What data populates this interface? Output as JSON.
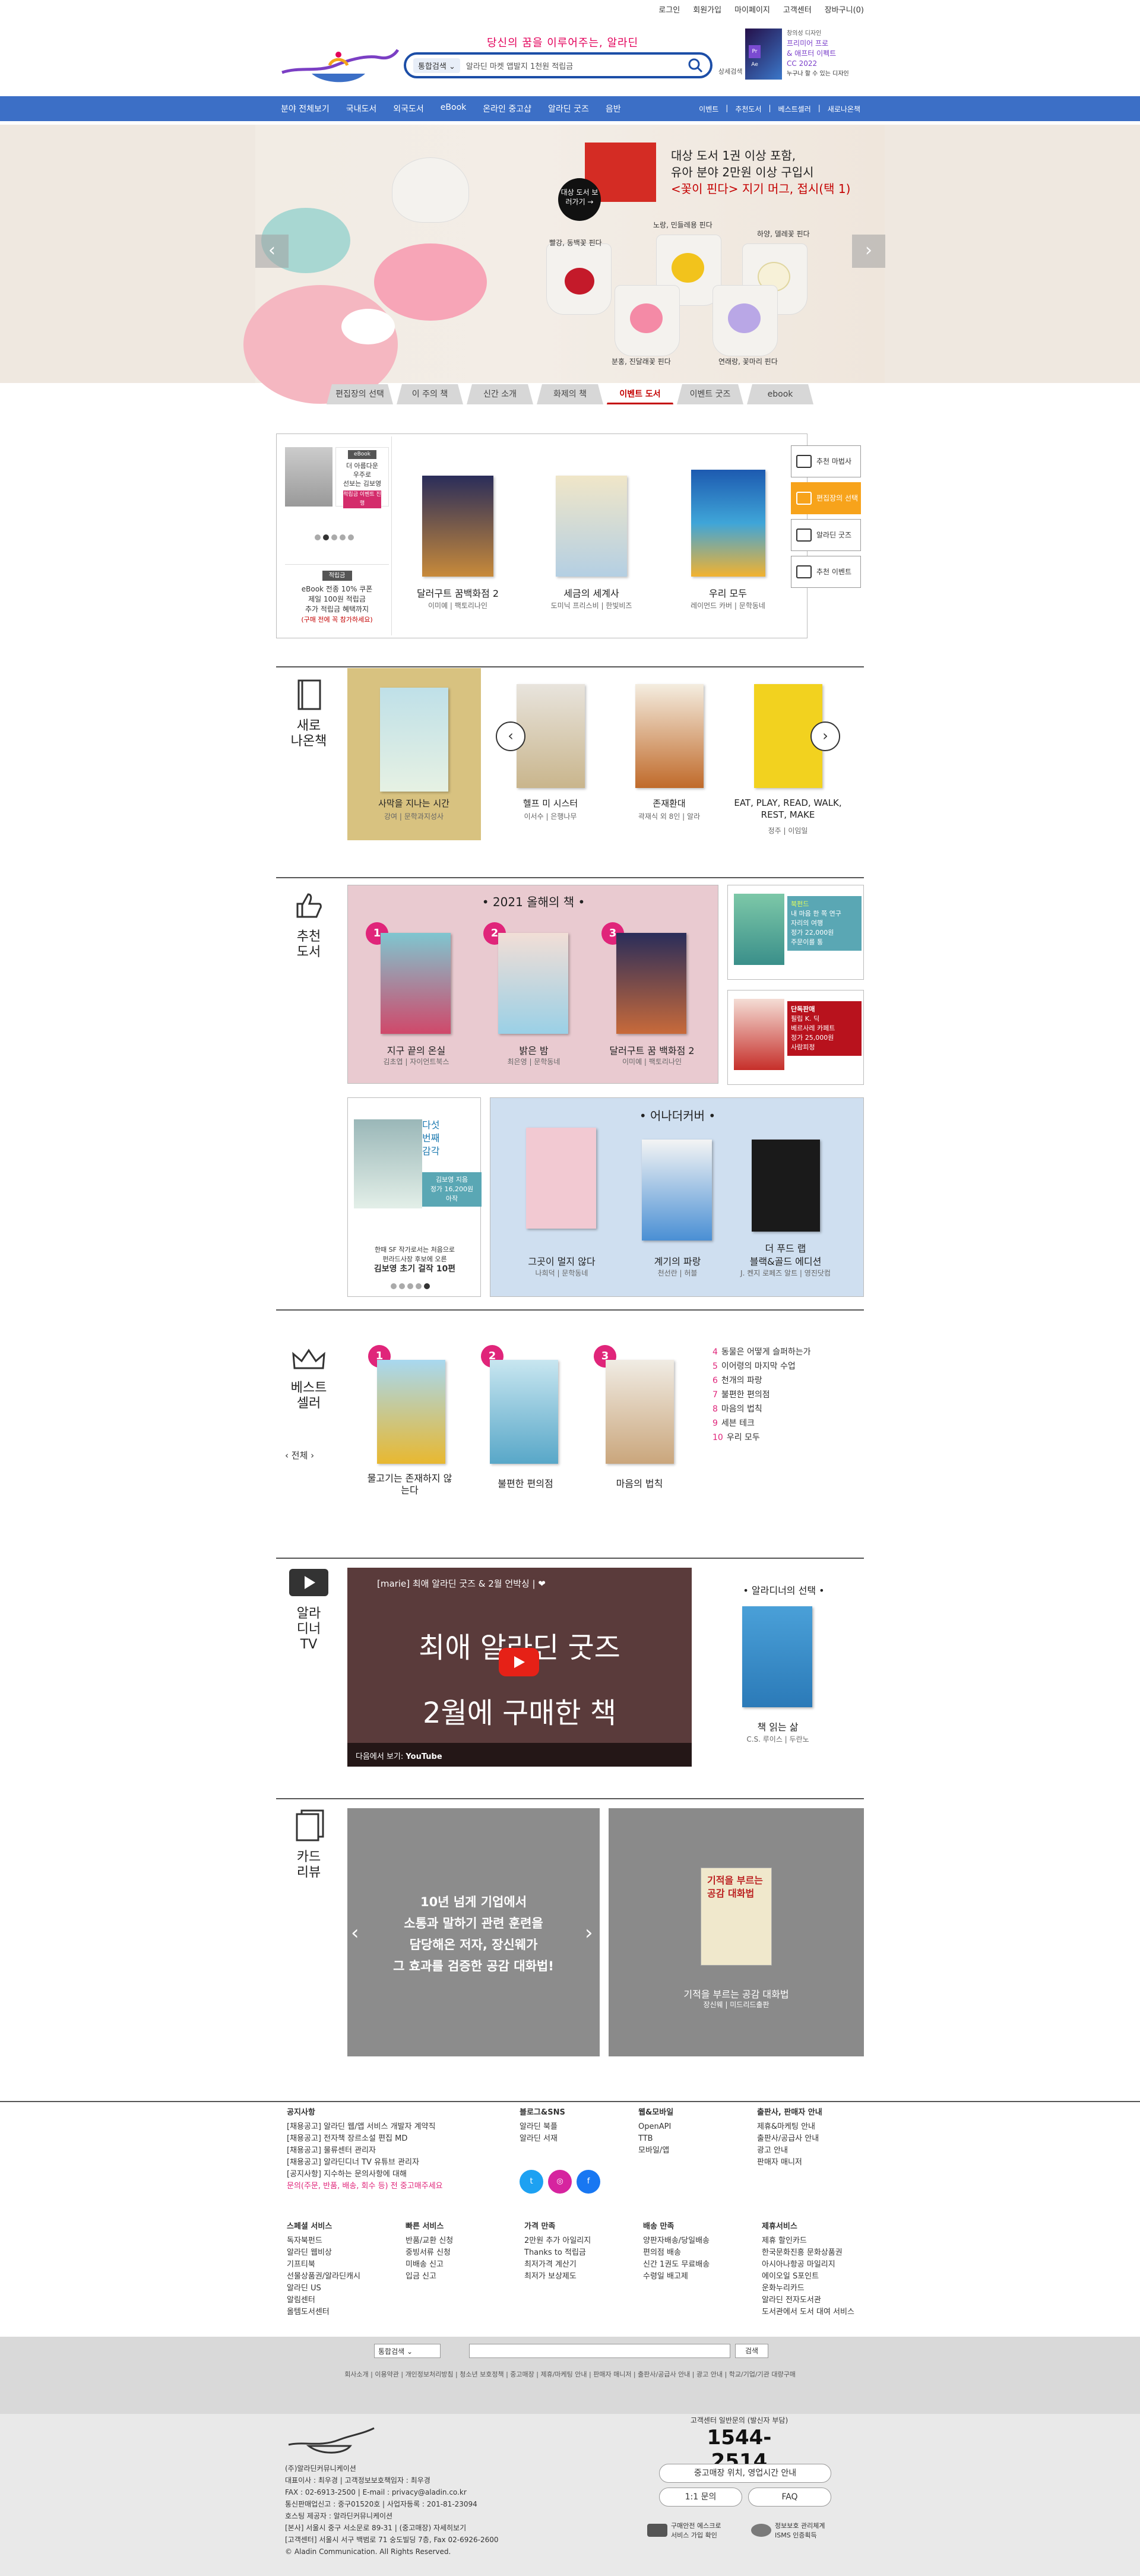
{
  "toplinks": [
    "로그인",
    "회원가입",
    "마이페이지",
    "고객센터",
    "장바구니(0)"
  ],
  "header": {
    "slogan": "당신의 꿈을 이루어주는, 알라딘",
    "search_category": "통합검색",
    "search_query": "알라딘 마켓 앱발지 1천원 적립금",
    "detail_search": "상세검색",
    "ad_lines": [
      "창의성 디자인",
      "프리미어 프로",
      "& 애프터 이펙트",
      "CC 2022",
      "누구나 할 수 있는 디자인"
    ]
  },
  "nav": {
    "left": [
      "분야 전체보기",
      "국내도서",
      "외국도서",
      "eBook",
      "온라인 중고샵",
      "알라딘 굿즈",
      "음반"
    ],
    "right": [
      "이벤트",
      "추천도서",
      "베스트셀러",
      "새로나온책"
    ]
  },
  "banner": {
    "line1": "대상 도서 1권 이상 포함,",
    "line2": "유아 분야 2만원 이상 구입시",
    "line3": "<꽃이 핀다> 지기 머그, 접시(택 1)",
    "go_button": "대상 도서 보러가기 →",
    "labels": [
      "노랑, 민들레용 핀다",
      "하양, 델레꽃 핀다",
      "빨강, 동백꽃 핀다",
      "분홍, 진달래꽃 핀다",
      "연래랑, 꽃마리 핀다"
    ]
  },
  "tabs": [
    "편집장의 선택",
    "이 주의 책",
    "신간 소개",
    "화제의 책",
    "이벤트 도서",
    "이벤트 굿즈",
    "ebook"
  ],
  "editor": {
    "card_tag": "eBook",
    "card_text": [
      "더 아름다운",
      "우주로",
      "선보는 김보영"
    ],
    "card_pick": "적립금 이벤트 진행",
    "promo_tag": "적립금",
    "promo": [
      "eBook 전종 10% 쿠폰",
      "제일 100원 적립금",
      "추가 적립금 혜택까지"
    ],
    "promo_sub": "(구매 전에 꼭 참가하세요)",
    "books": [
      {
        "title": "달러구트 꿈백화점 2",
        "meta": "이미예 | 팩토리나인"
      },
      {
        "title": "세금의 세계사",
        "meta": "도미닉 프리스비 | 한빛비즈"
      },
      {
        "title": "우리 모두",
        "meta": "레이먼드 카버 | 문학동네"
      }
    ],
    "side_buttons": [
      "추천 마법사",
      "편집장의 선택",
      "알라딘 굿즈",
      "추천 이벤트"
    ]
  },
  "sections": {
    "new": "새로 나온책",
    "recommend": "추천 도서",
    "best": "베스트 셀러",
    "tv": "알라 디너 TV",
    "card": "카드 리뷰"
  },
  "newbooks": [
    {
      "title": "사막을 지나는 시간",
      "meta": "강여 | 문학과지성사"
    },
    {
      "title": "헬프 미 시스터",
      "meta": "이서수 | 은행나무"
    },
    {
      "title": "존재환대",
      "meta": "곽재식 외 8인 | 알라"
    },
    {
      "title": "EAT, PLAY, READ, WALK, REST, MAKE",
      "meta": "정주 | 이임일"
    }
  ],
  "recommend": {
    "year_title": "• 2021 올해의 책 •",
    "year_books": [
      {
        "rank": "1",
        "title": "지구 끝의 온실",
        "meta": "김초엽 | 자이언트북스"
      },
      {
        "rank": "2",
        "title": "밝은 밤",
        "meta": "최은영 | 문학동네"
      },
      {
        "rank": "3",
        "title": "달러구트 꿈 백화점 2",
        "meta": "이미예 | 팩토리나인"
      }
    ],
    "side1": {
      "tag": "북펀드",
      "text": [
        "내 마음 한 쪽 연구",
        "자리의 여행"
      ],
      "price": "정가 22,000원",
      "sub": "주문이를 통"
    },
    "side2": {
      "tag": "단독판매",
      "text": [
        "필립 K. 딕",
        "베르사레 카페트"
      ],
      "price": "정가 25,000원",
      "sub": "사람피정"
    },
    "sf": {
      "head": [
        "다섯",
        "번째",
        "감각"
      ],
      "author": "김보영 지음",
      "price": "정가 16,200원",
      "sub": "아작",
      "desc": [
        "한때 SF 작가로서는 처음으로",
        "펀라드사장 후보에 오른",
        "김보영 초기 걸작 10편"
      ]
    },
    "another_title": "• 어나더커버 •",
    "another_books": [
      {
        "title": "그곳이 멀지 않다",
        "meta": "나희덕 | 문학동네"
      },
      {
        "title": "계기의 파랑",
        "meta": "천선란 | 허블"
      },
      {
        "title": "더 푸드 랩",
        "meta": "블랙&골드 에디션",
        "meta2": "J. 켄지 로페즈 알트 | 영진닷컴"
      }
    ]
  },
  "best": {
    "nav": "전체",
    "top": [
      {
        "rank": "1",
        "title": "물고기는 존재하지 않는다"
      },
      {
        "rank": "2",
        "title": "불편한 편의점"
      },
      {
        "rank": "3",
        "title": "마음의 법칙"
      }
    ],
    "list": [
      {
        "n": "4",
        "t": "동물은 어떻게 슬퍼하는가"
      },
      {
        "n": "5",
        "t": "이어령의 마지막 수업"
      },
      {
        "n": "6",
        "t": "천개의 파랑"
      },
      {
        "n": "7",
        "t": "불편한 편의점"
      },
      {
        "n": "8",
        "t": "마음의 법칙"
      },
      {
        "n": "9",
        "t": "세븐 테크"
      },
      {
        "n": "10",
        "t": "우리 모두"
      }
    ]
  },
  "tv": {
    "video_title": "[marie] 최애 알라딘 굿즈 & 2월 언박싱 | ❤",
    "video_main": [
      "최애 알라딘 굿즈",
      "2월에 구매한 책"
    ],
    "watch_on": "다음에서 보기:",
    "yt": "YouTube",
    "choice_title": "• 알라디너의 선택 •",
    "choice_book": "책 읽는 삶",
    "choice_meta": "C.S. 루이스 | 두란노"
  },
  "cards": {
    "card1": [
      "10년 넘게 기업에서",
      "소통과 말하기 관련 훈련을",
      "담당해온 저자, 장신웨가",
      "그 효과를 검증한 공감 대화법!"
    ],
    "card2_title": "기적을 부르는 공감 대화법",
    "card2_meta": "장신웨 | 미드리드출판",
    "card2_cover": "기적을 부르는 공감 대화법"
  },
  "footer": {
    "col1_title": "공지사항",
    "col1": [
      "[채용공고] 알라딘 웹/앱 서비스 개발자 계약직",
      "[채용공고] 전자책 장르소설 편집 MD",
      "[채용공고] 물류센터 관리자",
      "[채용공고] 알라딘디너 TV 유튜브 관리자",
      "[공지사항] 지수하는 문의사항에 대해"
    ],
    "col1_pink": "문의(주문, 반품, 배송, 회수 등) 전 중고매주세요",
    "col2_title": "블로그&SNS",
    "col2": [
      "알라딘 북플",
      "알라딘 서재"
    ],
    "col3_title": "웹&모바일",
    "col3": [
      "OpenAPI",
      "TTB",
      "모바일/앱"
    ],
    "col4_title": "출판사, 판매자 안내",
    "col4": [
      "제휴&마케팅 안내",
      "출판사/공급사 안내",
      "광고 안내",
      "판매자 매니저"
    ],
    "row2": [
      {
        "t": "스페셜 서비스",
        "items": [
          "독자북펀드",
          "알라딘 웹비상",
          "기프티북",
          "선물상품권/알라딘캐시",
          "알라딘 US",
          "알림센터",
          "올템도서센터"
        ]
      },
      {
        "t": "빠른 서비스",
        "items": [
          "반품/교환 신청",
          "중빙서류 신청",
          "미배송 신고",
          "입금 신고"
        ]
      },
      {
        "t": "가격 만족",
        "items": [
          "2만원 추가 아일리지",
          "Thanks to 적립금",
          "최저가격 계산기",
          "최저가 보상제도"
        ]
      },
      {
        "t": "배송 만족",
        "items": [
          "양판자배송/당일배송",
          "편의점 배송",
          "신간 1권도 무료배송",
          "수령일 배고제"
        ]
      },
      {
        "t": "제휴서비스",
        "items": [
          "제휴 할인카드",
          "한국문화진흥 문화상품권",
          "아시아나항공 마일리지",
          "에이오일 S포인트",
          "운화누리카드",
          "알라딘 전자도서관",
          "도서관에서 도서 대여 서비스"
        ]
      }
    ],
    "search_cat": "통합검색",
    "search_btn": "검색",
    "links": [
      "회사소개",
      "이용약관",
      "개인정보처리방침",
      "청소년 보호정책",
      "중고매장",
      "제휴/마케팅 안내",
      "판매자 매니저",
      "출판사/공급사 안내",
      "광고 안내",
      "학교/기업/기관 대량구매"
    ],
    "company": [
      "(주)알라딘커뮤니케이션",
      "대표이사 : 최우경 | 고객정보보호책임자 : 최우경",
      "FAX : 02-6913-2500 | E-mail : privacy@aladin.co.kr",
      "통신판매업신고 : 중구01520호 | 사업자등록 : 201-81-23094",
      "호스팅 제공자 : 알라딘커뮤니케이션",
      "[본사] 서울시 중구 서소문로 89-31 | (중고매장) 자세히보기",
      "[고객센터] 서울시 서구 백범로 71 숭도빌딩 7층, Fax 02-6926-2600",
      "© Aladin Communication. All Rights Reserved."
    ],
    "cs_title": "고객센터 일반문의 (발신자 부담)",
    "cs_phone": "1544-2514",
    "btn1": "중고매장 위치, 영업시간 안내",
    "btn2": "1:1 문의",
    "btn3": "FAQ",
    "cert1": [
      "구매안전 에스크로",
      "서비스 가입 확인"
    ],
    "cert2": [
      "정보보호 관리체계",
      "ISMS 인증획득"
    ]
  }
}
